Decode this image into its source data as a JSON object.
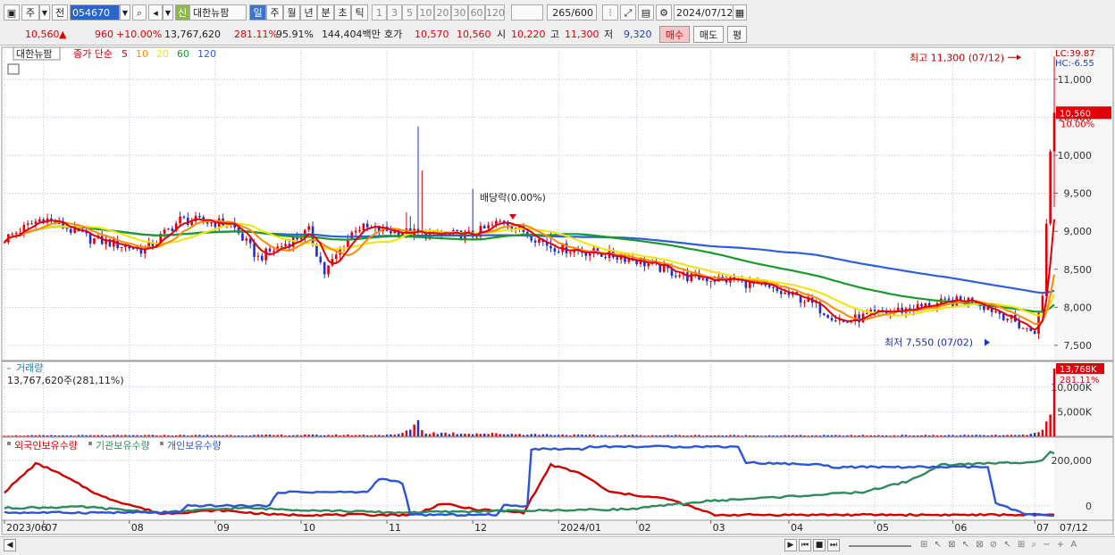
{
  "toolbar": {
    "period_type": "주",
    "prev": "전",
    "code": "054670",
    "badge": "신",
    "name": "대한뉴팜",
    "periods": [
      "일",
      "주",
      "월",
      "년",
      "분",
      "초",
      "틱"
    ],
    "active_period": "일",
    "intervals": [
      "1",
      "3",
      "5",
      "10",
      "20",
      "30",
      "60",
      "120"
    ],
    "count": "265",
    "count_total": "/600",
    "date": "2024/07/12"
  },
  "quote": {
    "price": "10,560",
    "change_symbol": "▲",
    "change": "960",
    "change_pct": "+10.00%",
    "volume": "13,767,620",
    "vol_ratio": "281.11%",
    "strength": "95.91%",
    "amount": "144,404백만",
    "ask_label": "호가",
    "ask": "10,570",
    "bid": "10,560",
    "open_label": "시",
    "open": "10,220",
    "high_label": "고",
    "high": "11,300",
    "low_label": "저",
    "low": "9,320",
    "buy": "매수",
    "sell": "매도",
    "eval": "평"
  },
  "colors": {
    "up": "#e0000a",
    "down": "#1f2fd0",
    "ma5": "#e0000a",
    "ma10": "#ff8a00",
    "ma20": "#f5e400",
    "ma60": "#1a9a2a",
    "ma120": "#2e5fd8",
    "grid": "#b8c4d6"
  },
  "chart_data": {
    "type": "candlestick",
    "ticker_name": "대한뉴팜",
    "legend": {
      "price_label": "종가 단순",
      "periods": [
        "5",
        "10",
        "20",
        "60",
        "120"
      ]
    },
    "price_axis": {
      "ticks": [
        7500,
        8000,
        8500,
        9000,
        9500,
        10000,
        10500,
        11000
      ],
      "labels": [
        "7,500",
        "8,000",
        "8,500",
        "9,000",
        "9,500",
        "10,000",
        "10,500",
        "11,000"
      ],
      "ylim": [
        7300,
        11350
      ]
    },
    "lc": "LC:39.87",
    "hc": "HC:-6.55",
    "last_price_label": "10,560",
    "last_pct_label": "10.00%",
    "high_annotation": "최고 11,300 (07/12)",
    "low_annotation": "최저 7,550 (07/02)",
    "dividend_annotation": "배당락(0.00%)",
    "x_labels": [
      "2023/06",
      "07",
      "08",
      "09",
      "10",
      "11",
      "12",
      "2024/01",
      "02",
      "03",
      "04",
      "05",
      "06",
      "07"
    ],
    "x_end_label": "07/12",
    "price_anchors": [
      [
        0,
        8900
      ],
      [
        10,
        9180
      ],
      [
        22,
        8900
      ],
      [
        36,
        8750
      ],
      [
        45,
        9150
      ],
      [
        58,
        9100
      ],
      [
        65,
        8650
      ],
      [
        78,
        9000
      ],
      [
        82,
        8450
      ],
      [
        90,
        9050
      ],
      [
        110,
        8950
      ],
      [
        120,
        8950
      ],
      [
        128,
        9150
      ],
      [
        140,
        8800
      ],
      [
        160,
        8650
      ],
      [
        175,
        8400
      ],
      [
        188,
        8350
      ],
      [
        205,
        8100
      ],
      [
        215,
        7800
      ],
      [
        222,
        7900
      ],
      [
        240,
        8050
      ],
      [
        248,
        8100
      ],
      [
        256,
        7900
      ],
      [
        262,
        7700
      ],
      [
        264,
        7700
      ],
      [
        266,
        8150
      ],
      [
        268,
        10050
      ],
      [
        269,
        10560
      ]
    ],
    "spikes": [
      [
        103,
        9250
      ],
      [
        104,
        9200
      ],
      [
        106,
        10380
      ],
      [
        107,
        9800
      ],
      [
        120,
        9560
      ],
      [
        140,
        9000
      ],
      [
        181,
        8250
      ]
    ],
    "volume_panel": {
      "title": "거래량",
      "summary": "13,767,620주(281,11%)",
      "ticks": [
        5000,
        10000
      ],
      "tick_labels": [
        "5,000K",
        "10,000K"
      ],
      "ylim": [
        0,
        14500
      ],
      "last_label": "13,768K",
      "last_pct": "281.11%",
      "anchors": [
        [
          0,
          180
        ],
        [
          100,
          300
        ],
        [
          103,
          900
        ],
        [
          104,
          1800
        ],
        [
          105,
          2500
        ],
        [
          106,
          4000
        ],
        [
          107,
          1100
        ],
        [
          108,
          700
        ],
        [
          120,
          600
        ],
        [
          150,
          250
        ],
        [
          200,
          200
        ],
        [
          262,
          250
        ],
        [
          265,
          800
        ],
        [
          266,
          2000
        ],
        [
          267,
          5000
        ],
        [
          268,
          3200
        ],
        [
          269,
          13768
        ]
      ]
    },
    "holdings_panel": {
      "series": [
        {
          "name": "외국인보유수량",
          "color": "#d00000",
          "anchors": [
            [
              0,
              60000
            ],
            [
              8,
              185000
            ],
            [
              12,
              160000
            ],
            [
              25,
              40000
            ],
            [
              40,
              -35000
            ],
            [
              55,
              -20000
            ],
            [
              70,
              -40000
            ],
            [
              85,
              -40000
            ],
            [
              105,
              -40000
            ],
            [
              112,
              10000
            ],
            [
              120,
              -15000
            ],
            [
              133,
              -30000
            ],
            [
              140,
              180000
            ],
            [
              148,
              140000
            ],
            [
              155,
              60000
            ],
            [
              170,
              30000
            ],
            [
              182,
              -40000
            ],
            [
              269,
              -40000
            ]
          ]
        },
        {
          "name": "기관보유수량",
          "color": "#2f8c5a",
          "anchors": [
            [
              0,
              -10000
            ],
            [
              20,
              -5000
            ],
            [
              40,
              -30000
            ],
            [
              60,
              -10000
            ],
            [
              80,
              -20000
            ],
            [
              100,
              -30000
            ],
            [
              120,
              -25000
            ],
            [
              140,
              -20000
            ],
            [
              160,
              -15000
            ],
            [
              180,
              20000
            ],
            [
              200,
              40000
            ],
            [
              220,
              60000
            ],
            [
              232,
              110000
            ],
            [
              240,
              180000
            ],
            [
              260,
              190000
            ],
            [
              266,
              200000
            ],
            [
              268,
              240000
            ],
            [
              269,
              230000
            ]
          ]
        },
        {
          "name": "개인보유수량",
          "color": "#2a55d8",
          "anchors": [
            [
              0,
              -30000
            ],
            [
              45,
              -30000
            ],
            [
              47,
              0
            ],
            [
              68,
              0
            ],
            [
              70,
              60000
            ],
            [
              93,
              60000
            ],
            [
              96,
              120000
            ],
            [
              102,
              100000
            ],
            [
              104,
              -40000
            ],
            [
              126,
              -40000
            ],
            [
              128,
              0
            ],
            [
              134,
              0
            ],
            [
              135,
              250000
            ],
            [
              148,
              250000
            ],
            [
              150,
              260000
            ],
            [
              188,
              260000
            ],
            [
              190,
              190000
            ],
            [
              210,
              180000
            ],
            [
              212,
              170000
            ],
            [
              252,
              170000
            ],
            [
              254,
              10000
            ],
            [
              262,
              -40000
            ],
            [
              269,
              -40000
            ]
          ]
        }
      ],
      "ticks": [
        0,
        200000
      ],
      "tick_labels": [
        "0",
        "200,000"
      ],
      "ylim": [
        -40000,
        270000
      ]
    }
  },
  "scrollbar": {
    "buttons": [
      "◀",
      "▶",
      "⏮",
      "■",
      "⏭"
    ]
  }
}
